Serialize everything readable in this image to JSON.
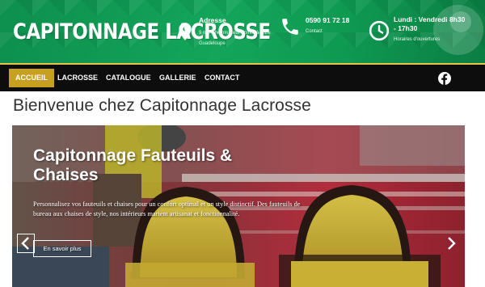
{
  "header": {
    "logo": "CAPITONNAGE LACROSSE",
    "address": {
      "title": "Adresse",
      "line": "9 rue Chemin Neuf Pointe-à-Pitre Guadeloupe",
      "icon": "map-pin-icon"
    },
    "phone": {
      "title": "0590 91 72 18",
      "sub": "Contact",
      "icon": "phone-icon"
    },
    "hours": {
      "title": "Lundi : Vendredi 8h30 - 17h30",
      "sub": "Horaires d'ouvertures",
      "icon": "clock-icon"
    }
  },
  "nav": {
    "items": [
      {
        "label": "ACCUEIL",
        "active": true
      },
      {
        "label": "LACROSSE"
      },
      {
        "label": "CATALOGUE"
      },
      {
        "label": "GALLERIE"
      },
      {
        "label": "CONTACT"
      }
    ],
    "social_icon": "facebook-icon"
  },
  "page": {
    "title": "Bienvenue chez Capitonnage Lacrosse"
  },
  "hero": {
    "heading": "Capitonnage Fauteuils & Chaises",
    "text": "Personnalisez vos fauteuils et chaises pour un confort optimal et un style distinctif. Des fauteuils de bureau aux chaises de style, nos intérieurs marient artisanat et fonctionnalité.",
    "button": "En savoir plus",
    "prev_icon": "chevron-left-icon",
    "next_icon": "chevron-right-icon"
  },
  "colors": {
    "header_green": "#13a55a",
    "gold": "#c8a01f",
    "nav_bg": "#0d0d0d"
  }
}
